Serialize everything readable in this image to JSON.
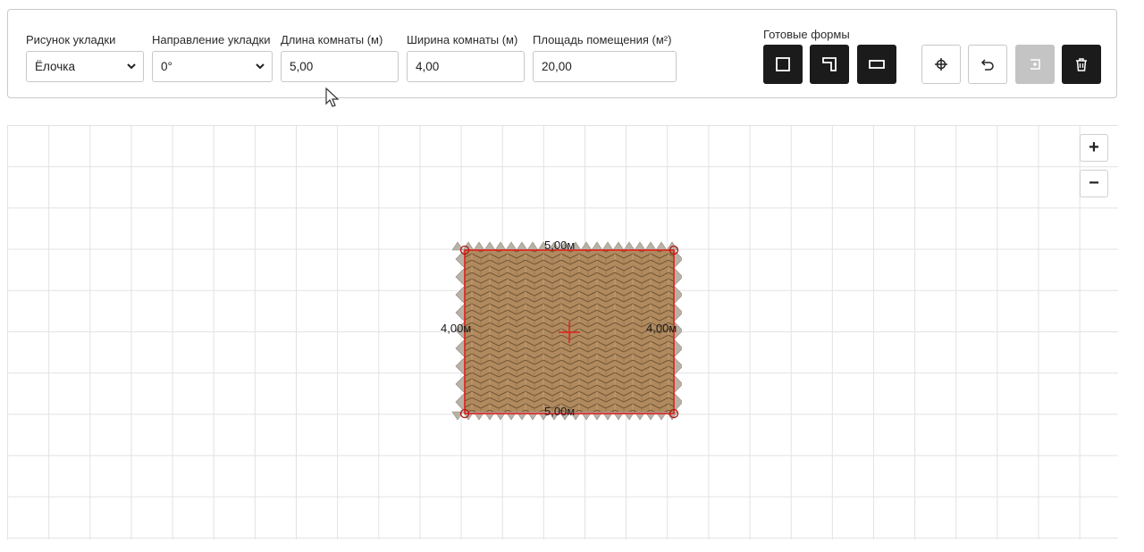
{
  "toolbar": {
    "pattern": {
      "label": "Рисунок укладки",
      "value": "Ёлочка"
    },
    "direction": {
      "label": "Направление укладки",
      "value": "0°"
    },
    "length": {
      "label": "Длина комнаты (м)",
      "value": "5,00"
    },
    "width": {
      "label": "Ширина комнаты (м)",
      "value": "4,00"
    },
    "area": {
      "label": "Площадь помещения (м²)",
      "value": "20,00"
    },
    "presets_label": "Готовые формы",
    "buttons": [
      {
        "icon": "square-shape-icon",
        "state": "active"
      },
      {
        "icon": "l-shape-icon",
        "state": "active"
      },
      {
        "icon": "rectangle-shape-icon",
        "state": "active"
      },
      {
        "icon": "center-crosshair-icon",
        "state": "enabled"
      },
      {
        "icon": "undo-icon",
        "state": "enabled"
      },
      {
        "icon": "add-point-icon",
        "state": "disabled"
      },
      {
        "icon": "trash-icon",
        "state": "active"
      }
    ]
  },
  "canvas": {
    "zoom_in": "+",
    "zoom_out": "−",
    "room": {
      "top_dimension": "5,00м",
      "bottom_dimension": "5,00м",
      "left_dimension": "4,00м",
      "right_dimension": "4,00м"
    }
  },
  "colors": {
    "accent": "#1b1b1b",
    "wall": "#e0201c",
    "wood": "#b08a5e"
  }
}
